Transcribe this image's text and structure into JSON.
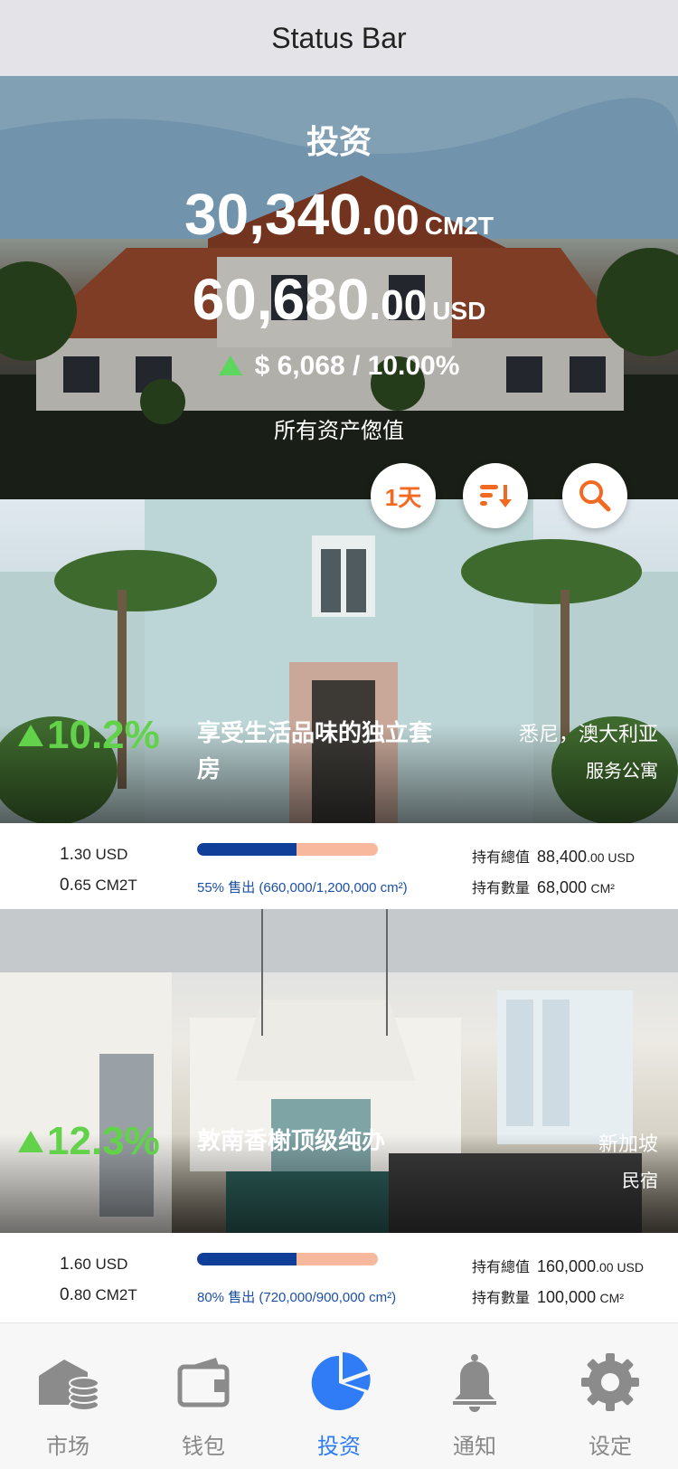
{
  "status_bar": {
    "label": "Status Bar"
  },
  "hero": {
    "title": "投资",
    "cm2t_int": "30,340",
    "cm2t_dec": ".00",
    "cm2t_unit": "CM2T",
    "usd_int": "60,680",
    "usd_dec": ".00",
    "usd_unit": "USD",
    "change": "$ 6,068  /  10.00%",
    "caption": "所有资产偬值"
  },
  "actions": {
    "period_label": "1天",
    "sort_icon": "sort-descending-icon",
    "search_icon": "search-icon"
  },
  "properties": [
    {
      "change_pct": "10.2%",
      "name": "享受生活品味的独立套房",
      "location": "悉尼，澳大利亚",
      "type": "服务公寓",
      "price_usd_major": "1.",
      "price_usd_minor": "30 USD",
      "price_cm2t_major": "0.",
      "price_cm2t_minor": "65 CM2T",
      "sold_fraction": 0.55,
      "sold_text": "55% 售出 (660,000/1,200,000 cm²)",
      "total_value_label": "持有總值",
      "total_value": "88,400",
      "total_value_dec": ".00 USD",
      "quantity_label": "持有數量",
      "quantity": "68,000",
      "quantity_unit": "CM²"
    },
    {
      "change_pct": "12.3%",
      "name": "敦南香榭顶级纯办",
      "location": "新加坡",
      "type": "民宿",
      "price_usd_major": "1.",
      "price_usd_minor": "60 USD",
      "price_cm2t_major": "0.",
      "price_cm2t_minor": "80 CM2T",
      "sold_fraction": 0.55,
      "sold_text": "80% 售出 (720,000/900,000 cm²)",
      "total_value_label": "持有總值",
      "total_value": "160,000",
      "total_value_dec": ".00 USD",
      "quantity_label": "持有數量",
      "quantity": "100,000",
      "quantity_unit": "CM²"
    }
  ],
  "nav": [
    {
      "label": "市场",
      "icon": "market-icon"
    },
    {
      "label": "钱包",
      "icon": "wallet-icon"
    },
    {
      "label": "投资",
      "icon": "investment-pie-icon",
      "active": true
    },
    {
      "label": "通知",
      "icon": "bell-icon"
    },
    {
      "label": "设定",
      "icon": "gear-icon"
    }
  ],
  "colors": {
    "accent": "#2f7cf6",
    "positive": "#62d24a",
    "action": "#f26a22",
    "bar_fill": "#0f3f98",
    "bar_track": "#f7b89e"
  }
}
